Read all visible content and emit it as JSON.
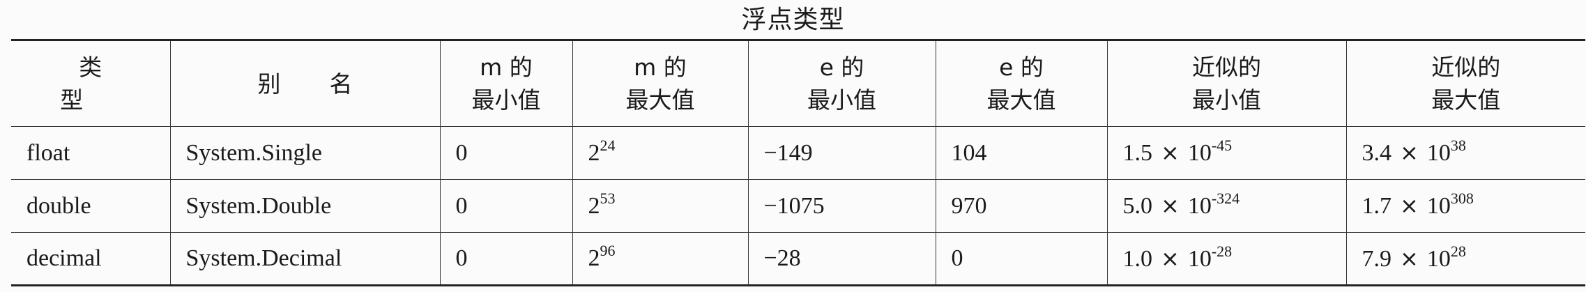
{
  "caption": "浮点类型",
  "table": {
    "headers": {
      "type": "类型",
      "alias": "别名",
      "m_min": [
        "m 的",
        "最小值"
      ],
      "m_max": [
        "m 的",
        "最大值"
      ],
      "e_min": [
        "e 的",
        "最小值"
      ],
      "e_max": [
        "e 的",
        "最大值"
      ],
      "approx_min": [
        "近似的",
        "最小值"
      ],
      "approx_max": [
        "近似的",
        "最大值"
      ]
    },
    "times_sign": "×",
    "rows": [
      {
        "type": "float",
        "alias": "System.Single",
        "m_min": "0",
        "m_max_base": "2",
        "m_max_exp": "24",
        "e_min": "−149",
        "e_max": "104",
        "approx_min_coef": "1.5",
        "approx_min_base": "10",
        "approx_min_exp": "-45",
        "approx_max_coef": "3.4",
        "approx_max_base": "10",
        "approx_max_exp": "38"
      },
      {
        "type": "double",
        "alias": "System.Double",
        "m_min": "0",
        "m_max_base": "2",
        "m_max_exp": "53",
        "e_min": "−1075",
        "e_max": "970",
        "approx_min_coef": "5.0",
        "approx_min_base": "10",
        "approx_min_exp": "-324",
        "approx_max_coef": "1.7",
        "approx_max_base": "10",
        "approx_max_exp": "308"
      },
      {
        "type": "decimal",
        "alias": "System.Decimal",
        "m_min": "0",
        "m_max_base": "2",
        "m_max_exp": "96",
        "e_min": "−28",
        "e_max": "0",
        "approx_min_coef": "1.0",
        "approx_min_base": "10",
        "approx_min_exp": "-28",
        "approx_max_coef": "7.9",
        "approx_max_base": "10",
        "approx_max_exp": "28"
      }
    ]
  }
}
